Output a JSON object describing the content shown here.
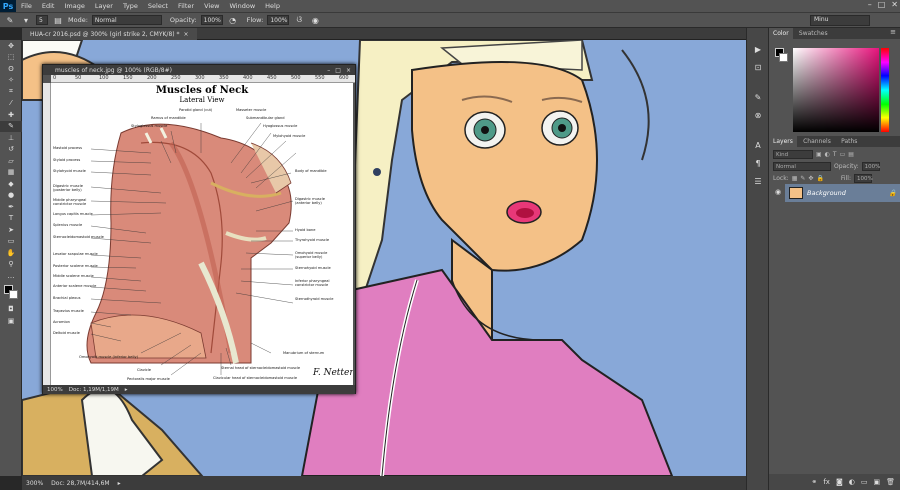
{
  "app": {
    "logo": "Ps"
  },
  "menu": [
    "File",
    "Edit",
    "Image",
    "Layer",
    "Type",
    "Select",
    "Filter",
    "View",
    "Window",
    "Help"
  ],
  "window_controls": [
    "–",
    "□",
    "✕"
  ],
  "options": {
    "brush_size": "5",
    "mode_label": "Mode:",
    "mode_value": "Normal",
    "opacity_label": "Opacity:",
    "opacity_value": "100%",
    "flow_label": "Flow:",
    "flow_value": "100%",
    "workspace": "Minu"
  },
  "document": {
    "tab_title": "HUA-cr 2016.psd @ 300% (girl strike 2, CMYK/8) *",
    "zoom": "300%",
    "doc_info": "Doc: 28,7M/414,6M"
  },
  "subwindow": {
    "title": "muscles of neck.jpg @ 100% (RGB/8#)",
    "ruler_ticks": [
      "0",
      "50",
      "100",
      "150",
      "200",
      "250",
      "300",
      "350",
      "400",
      "450",
      "500",
      "550",
      "600"
    ],
    "zoom": "100%",
    "doc_info": "Doc: 1,19M/1,19M"
  },
  "illustration": {
    "title": "Muscles of Neck",
    "subtitle": "Lateral View",
    "signature": "F. Netter",
    "labels_left": [
      "Mastoid process",
      "Styloid process",
      "Stylohyoid muscle",
      "Digastric muscle (posterior belly)",
      "Middle pharyngeal constrictor muscle",
      "Longus capitis muscle",
      "Splenius muscle",
      "Sternocleidomastoid muscle",
      "Levator scapulae muscle",
      "Posterior scalene muscle",
      "Middle scalene muscle",
      "Anterior scalene muscle",
      "Brachial plexus",
      "Trapezius muscle",
      "Acromion",
      "Deltoid muscle"
    ],
    "labels_top": [
      "Parotid gland (cut)",
      "Ramus of mandible",
      "Styloglossus muscle",
      "Masseter muscle",
      "Submandibular gland",
      "Hyoglossus muscle",
      "Mylohyoid muscle"
    ],
    "labels_right": [
      "Body of mandible",
      "Digastric muscle (anterior belly)",
      "Hyoid bone",
      "Thyrohyoid muscle",
      "Omohyoid muscle (superior belly)",
      "Sternohyoid muscle",
      "Inferior pharyngeal constrictor muscle",
      "Sternothyroid muscle"
    ],
    "labels_bottom": [
      "Omohyoid muscle (inferior belly)",
      "Clavicle",
      "Pectoralis major muscle",
      "Clavicular head of sternocleidomastoid muscle",
      "Sternal head of sternocleidomastoid muscle",
      "Manubrium of sternum"
    ]
  },
  "panels": {
    "color_tabs": [
      "Color",
      "Swatches"
    ],
    "layer_tabs": [
      "Layers",
      "Channels",
      "Paths"
    ],
    "kind_label": "Kind",
    "blend_mode": "Normal",
    "opacity_label": "Opacity:",
    "opacity_value": "100%",
    "lock_label": "Lock:",
    "fill_label": "Fill:",
    "fill_value": "100%",
    "layer_name": "Background"
  },
  "colors": {
    "skin": "#f4c187",
    "hair": "#f6f0c4",
    "jacket": "#e07ec0",
    "sky": "#88a8d8",
    "eye": "#4f9a88"
  }
}
